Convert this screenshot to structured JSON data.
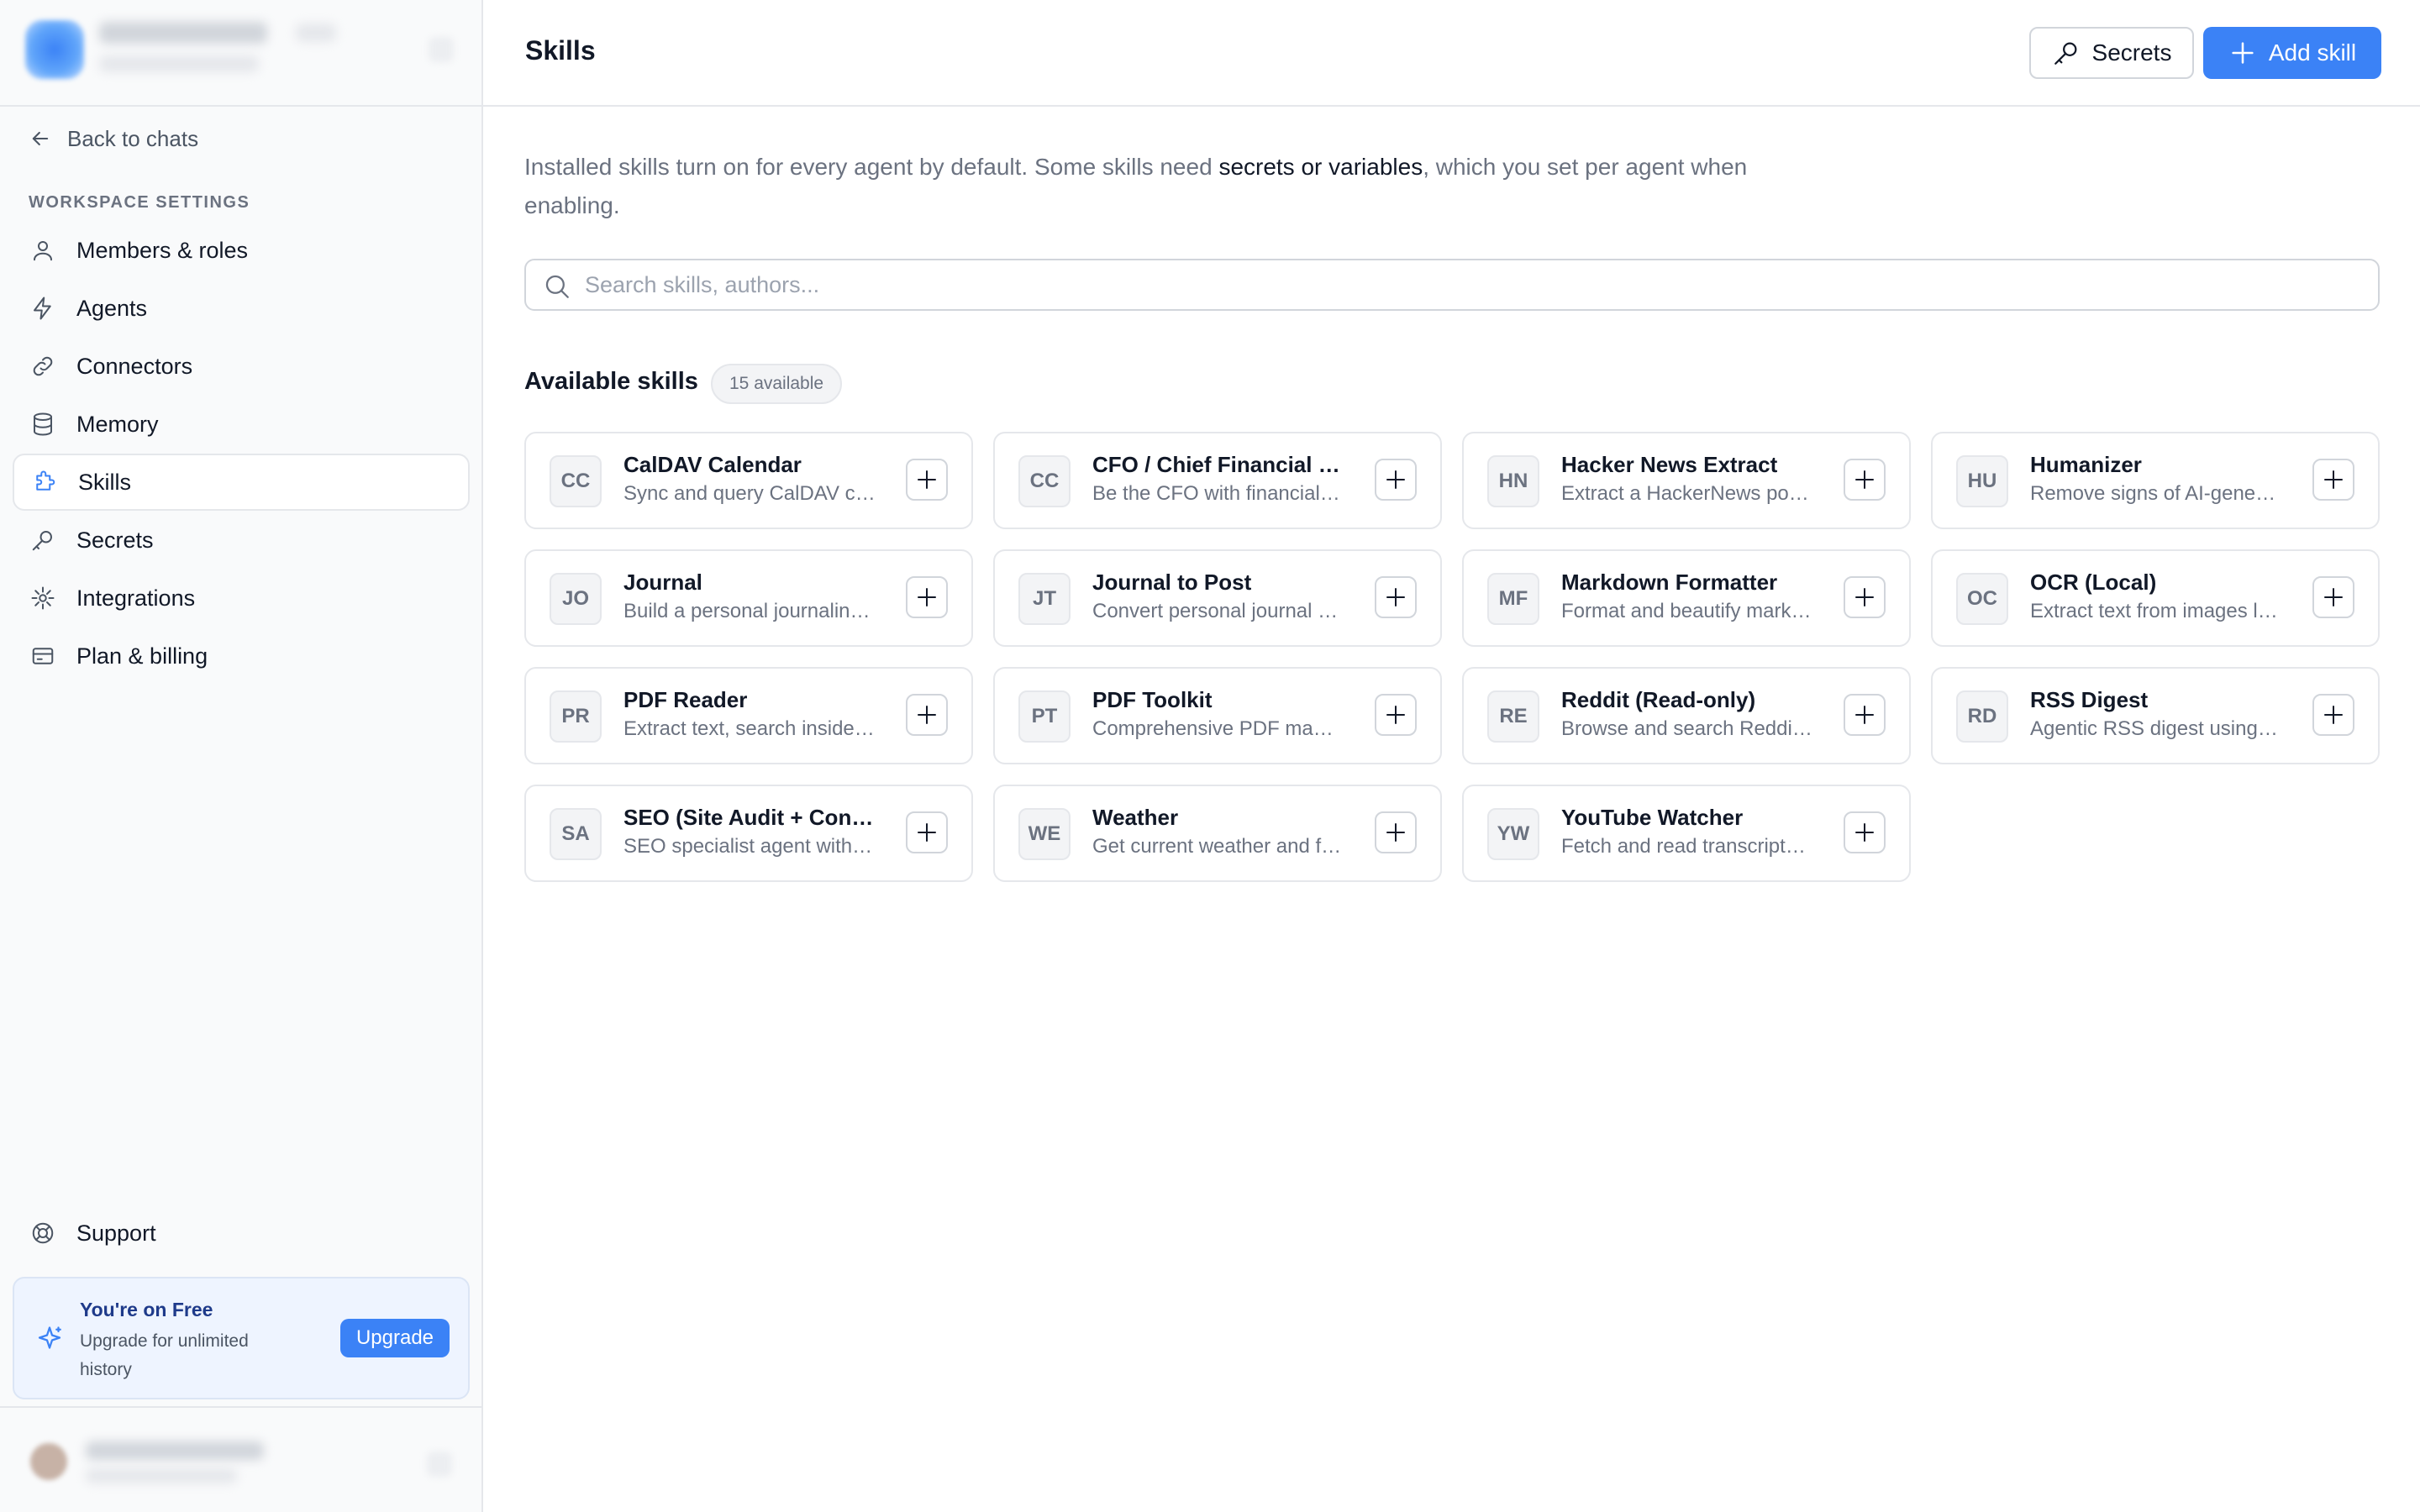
{
  "sidebar": {
    "back_label": "Back to chats",
    "section_label": "WORKSPACE SETTINGS",
    "items": [
      {
        "label": "Members & roles",
        "icon": "user-icon"
      },
      {
        "label": "Agents",
        "icon": "bolt-icon"
      },
      {
        "label": "Connectors",
        "icon": "link-icon"
      },
      {
        "label": "Memory",
        "icon": "database-icon"
      },
      {
        "label": "Skills",
        "icon": "puzzle-icon",
        "active": true
      },
      {
        "label": "Secrets",
        "icon": "key-icon"
      },
      {
        "label": "Integrations",
        "icon": "plug-icon"
      },
      {
        "label": "Plan & billing",
        "icon": "credit-card-icon"
      }
    ],
    "support_label": "Support",
    "upgrade": {
      "title": "You're on Free",
      "subtitle": "Upgrade for unlimited history",
      "button": "Upgrade"
    }
  },
  "header": {
    "title": "Skills",
    "secrets_button": "Secrets",
    "add_button": "Add skill"
  },
  "intro": {
    "before": "Installed skills turn on for every agent by default. Some skills need ",
    "emphasis": "secrets or variables",
    "after": ", which you set per agent when enabling."
  },
  "search": {
    "placeholder": "Search skills, authors..."
  },
  "available": {
    "title": "Available skills",
    "badge": "15 available"
  },
  "skills": [
    {
      "abbr": "CC",
      "name": "CalDAV Calendar",
      "desc": "Sync and query CalDAV calendars"
    },
    {
      "abbr": "CC",
      "name": "CFO / Chief Financial Officer",
      "desc": "Be the CFO with financial analysis"
    },
    {
      "abbr": "HN",
      "name": "Hacker News Extract",
      "desc": "Extract a HackerNews post and comments"
    },
    {
      "abbr": "HU",
      "name": "Humanizer",
      "desc": "Remove signs of AI-generated writing"
    },
    {
      "abbr": "JO",
      "name": "Journal",
      "desc": "Build a personal journaling habit"
    },
    {
      "abbr": "JT",
      "name": "Journal to Post",
      "desc": "Convert personal journal entries into posts"
    },
    {
      "abbr": "MF",
      "name": "Markdown Formatter",
      "desc": "Format and beautify markdown files"
    },
    {
      "abbr": "OC",
      "name": "OCR (Local)",
      "desc": "Extract text from images locally"
    },
    {
      "abbr": "PR",
      "name": "PDF Reader",
      "desc": "Extract text, search inside PDFs"
    },
    {
      "abbr": "PT",
      "name": "PDF Toolkit",
      "desc": "Comprehensive PDF manipulation"
    },
    {
      "abbr": "RE",
      "name": "Reddit (Read-only)",
      "desc": "Browse and search Reddit posts"
    },
    {
      "abbr": "RD",
      "name": "RSS Digest",
      "desc": "Agentic RSS digest using feeds"
    },
    {
      "abbr": "SA",
      "name": "SEO (Site Audit + Content Writer)",
      "desc": "SEO specialist agent with site audits"
    },
    {
      "abbr": "WE",
      "name": "Weather",
      "desc": "Get current weather and forecasts"
    },
    {
      "abbr": "YW",
      "name": "YouTube Watcher",
      "desc": "Fetch and read transcripts from YouTube"
    }
  ],
  "colors": {
    "accent": "#3b82f6",
    "sidebar_bg": "#f9fafb",
    "border": "#e5e7eb"
  }
}
